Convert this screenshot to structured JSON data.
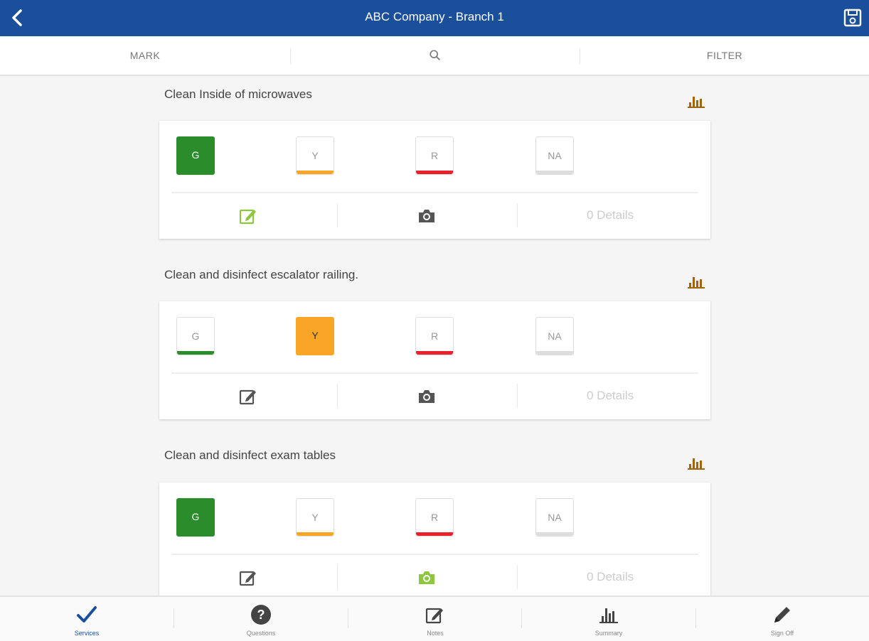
{
  "header": {
    "title": "ABC Company - Branch 1"
  },
  "toolbar": {
    "mark": "MARK",
    "filter": "FILTER"
  },
  "colors": {
    "header": "#1a4f9c",
    "green": "#2a8c2a",
    "yellow": "#f9a627",
    "red": "#e8212b",
    "gray": "#dddddd",
    "accent_olive": "#8dc63f",
    "chart_icon": "#a0650f"
  },
  "ratings": {
    "g": "G",
    "y": "Y",
    "r": "R",
    "na": "NA"
  },
  "tasks": [
    {
      "title": "Clean Inside of microwaves",
      "selected": "G",
      "details": "0 Details",
      "notes_active": true,
      "camera_active": false
    },
    {
      "title": "Clean and disinfect escalator railing.",
      "selected": "Y",
      "details": "0 Details",
      "notes_active": false,
      "camera_active": false
    },
    {
      "title": "Clean and disinfect exam tables",
      "selected": "G",
      "details": "0 Details",
      "notes_active": false,
      "camera_active": true
    }
  ],
  "bottom_nav": [
    {
      "label": "Services",
      "icon": "checkmark-icon",
      "active": true
    },
    {
      "label": "Questions",
      "icon": "question-circle-icon",
      "active": false
    },
    {
      "label": "Notes",
      "icon": "edit-icon",
      "active": false
    },
    {
      "label": "Summary",
      "icon": "bar-chart-icon",
      "active": false
    },
    {
      "label": "Sign Off",
      "icon": "pencil-icon",
      "active": false
    }
  ]
}
